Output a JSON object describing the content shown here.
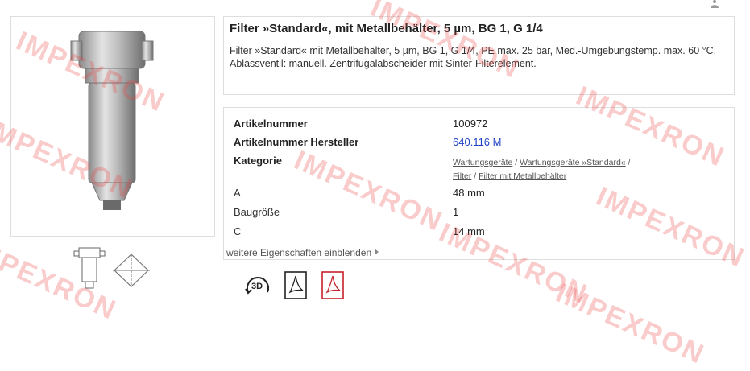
{
  "product": {
    "title": "Filter »Standard«, mit Metallbehälter, 5 µm, BG 1, G 1/4",
    "description": "Filter »Standard« mit Metallbehälter, 5 µm, BG 1, G 1/4, PE max. 25 bar, Med.-Umgebungstemp. max. 60 °C, Ablassventil: manuell. Zentrifugalabscheider mit Sinter-Filterelement."
  },
  "properties": {
    "rows": [
      {
        "label": "Artikelnummer",
        "value": "100972"
      },
      {
        "label": "Artikelnummer Hersteller",
        "value": "640.116 M"
      },
      {
        "label": "Kategorie",
        "value": ""
      },
      {
        "label": "A",
        "value": "48 mm"
      },
      {
        "label": "Baugröße",
        "value": "1"
      },
      {
        "label": "C",
        "value": "14 mm"
      }
    ],
    "category_path": {
      "link1": "Wartungsgeräte",
      "sep1": " / ",
      "link2": "Wartungsgeräte »Standard«",
      "sep2": " /",
      "link3": "Filter",
      "sep3": " / ",
      "link4": "Filter mit Metallbehälter"
    },
    "more_label": "weitere Eigenschaften einblenden"
  },
  "actions": {
    "icons": [
      "3d-view-icon",
      "pdf-icon",
      "pdf-icon"
    ],
    "three_d_label": "3D"
  },
  "watermark": {
    "text": "IMPEXRON",
    "color": "#e84646"
  },
  "colors": {
    "link": "#1e3fc8",
    "border": "#dedede"
  }
}
